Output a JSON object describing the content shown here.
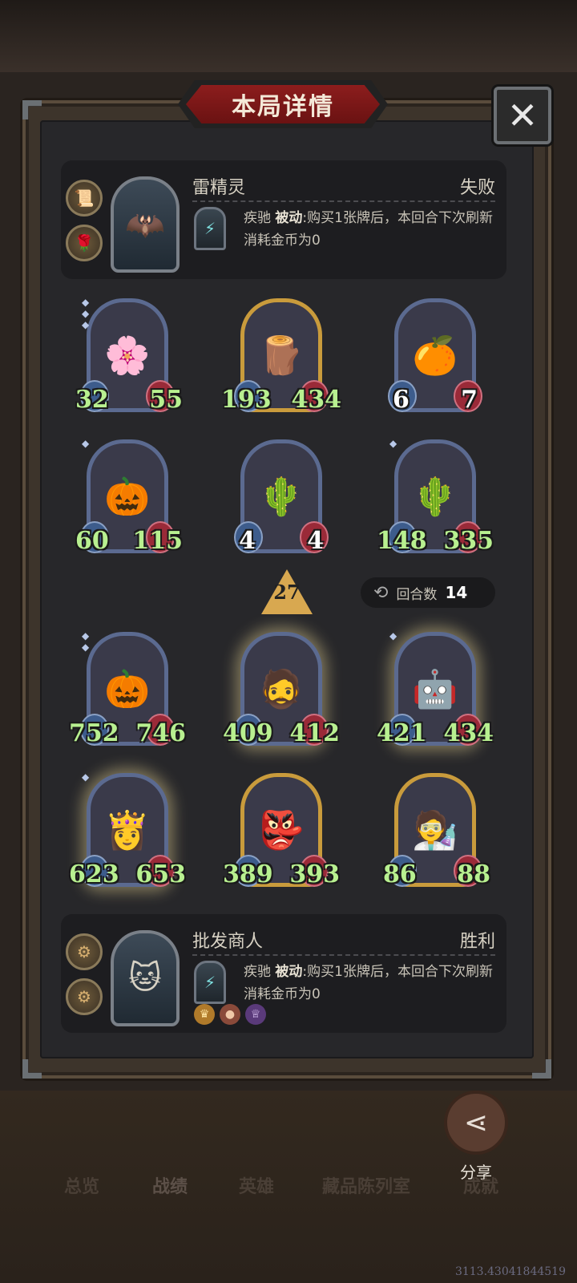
{
  "title": "本局详情",
  "close_icon": "✕",
  "players": {
    "top": {
      "name": "雷精灵",
      "result": "失败",
      "skill_name": "疾驰",
      "skill_type": "被动",
      "skill_desc": ":购买1张牌后，本回合下次刷新消耗金币为0",
      "items": [
        "scroll-icon",
        "rose-icon"
      ],
      "portrait": "thunder-spirit-portrait"
    },
    "bottom": {
      "name": "批发商人",
      "result": "胜利",
      "skill_name": "疾驰",
      "skill_type": "被动",
      "skill_desc": ":购买1张牌后，本回合下次刷新消耗金币为0",
      "items": [
        "gear-coin-icon",
        "gear-coin-icon"
      ],
      "portrait": "wholesaler-cat-portrait",
      "badges": [
        "crown-badge",
        "coin-badge",
        "trophy-badge"
      ]
    }
  },
  "enemy_units": [
    {
      "atk": "32",
      "hp": "55",
      "icon": "🌸"
    },
    {
      "atk": "193",
      "hp": "434",
      "icon": "🪵"
    },
    {
      "atk": "6",
      "hp": "7",
      "icon": "🍊"
    },
    {
      "atk": "60",
      "hp": "115",
      "icon": "🎃"
    },
    {
      "atk": "4",
      "hp": "4",
      "icon": "🌵"
    },
    {
      "atk": "148",
      "hp": "335",
      "icon": "🌵"
    }
  ],
  "level_indicator": "27",
  "round": {
    "label": "回合数",
    "value": "14"
  },
  "my_units": [
    {
      "atk": "752",
      "hp": "746",
      "icon": "🎃"
    },
    {
      "atk": "409",
      "hp": "412",
      "icon": "🧔"
    },
    {
      "atk": "421",
      "hp": "434",
      "icon": "🤖"
    },
    {
      "atk": "623",
      "hp": "653",
      "icon": "👸"
    },
    {
      "atk": "389",
      "hp": "393",
      "icon": "👺"
    },
    {
      "atk": "86",
      "hp": "88",
      "icon": "🧑‍🔬"
    }
  ],
  "share_label": "分享",
  "tabs": [
    "总览",
    "战绩",
    "英雄",
    "藏品陈列室",
    "成就"
  ],
  "coords_text": "3113.43041844519"
}
